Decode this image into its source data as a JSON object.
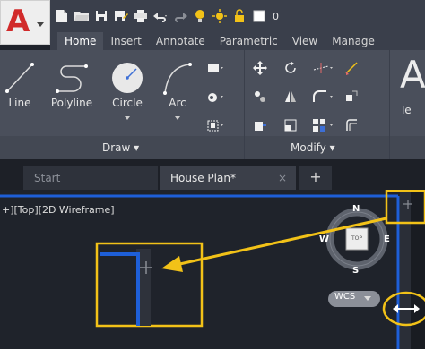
{
  "qat": {
    "app_letter": "A",
    "layer_number": "0"
  },
  "tabs": [
    "Home",
    "Insert",
    "Annotate",
    "Parametric",
    "View",
    "Manage"
  ],
  "ribbon": {
    "draw_tools": [
      "Line",
      "Polyline",
      "Circle",
      "Arc"
    ],
    "draw_panel_label": "Draw ▾",
    "modify_panel_label": "Modify ▾",
    "text_tool_partial": "Te"
  },
  "file_tabs": {
    "start": "Start",
    "active": "House Plan*",
    "close_glyph": "×",
    "new_glyph": "+"
  },
  "viewport": {
    "label": "+][Top][2D Wireframe]",
    "viewcube": {
      "north": "N",
      "south": "S",
      "east": "E",
      "west": "W",
      "face": "TOP"
    },
    "wcs_label": "WCS",
    "split_handle_glyph": "+"
  },
  "colors": {
    "highlight": "#f2c218",
    "viewport_border": "#1e5fd8"
  }
}
